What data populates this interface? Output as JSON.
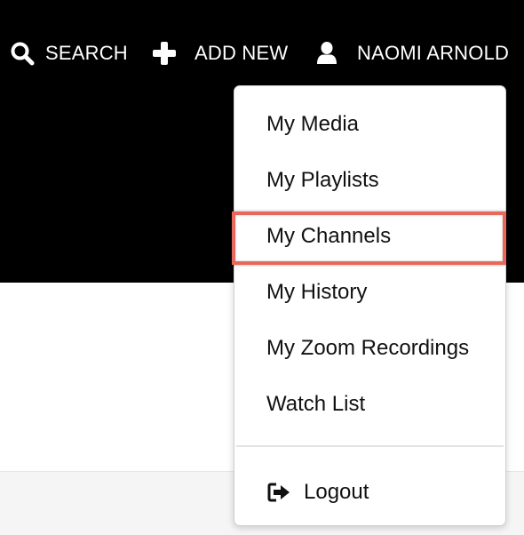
{
  "header": {
    "search_label": "SEARCH",
    "search_icon": "search-icon",
    "add_new_label": "ADD NEW",
    "add_icon": "plus-icon",
    "user_name": "NAOMI ARNOLD",
    "user_icon": "user-icon",
    "background_color": "#000000",
    "text_color": "#ffffff"
  },
  "user_menu": {
    "items": [
      {
        "label": "My Media"
      },
      {
        "label": "My Playlists"
      },
      {
        "label": "My Channels",
        "highlighted": true
      },
      {
        "label": "My History"
      },
      {
        "label": "My Zoom Recordings"
      },
      {
        "label": "Watch List"
      }
    ],
    "logout_label": "Logout",
    "logout_icon": "logout-icon",
    "highlight_color": "#e8695c"
  }
}
